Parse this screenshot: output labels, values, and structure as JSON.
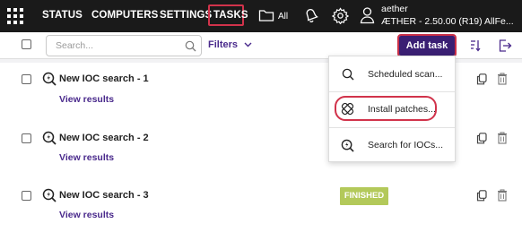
{
  "topbar": {
    "nav": [
      "STATUS",
      "COMPUTERS",
      "SETTINGS",
      "TASKS"
    ],
    "all_label": "All",
    "user_name": "aether",
    "user_version": "ÆTHER - 2.50.00 (R19) AllFe..."
  },
  "toolbar": {
    "search_placeholder": "Search...",
    "filters_label": "Filters",
    "add_task_label": "Add task"
  },
  "tasks": [
    {
      "title": "New IOC search - 1",
      "link": "View results",
      "status": ""
    },
    {
      "title": "New IOC search - 2",
      "link": "View results",
      "status": ""
    },
    {
      "title": "New IOC search - 3",
      "link": "View results",
      "status": "FINISHED"
    }
  ],
  "menu": {
    "items": [
      "Scheduled scan...",
      "Install patches...",
      "Search for IOCs..."
    ]
  },
  "colors": {
    "topbar_bg": "#1a1a1a",
    "accent": "#3a1f73",
    "link": "#4a2a8c",
    "highlight": "#d1334b",
    "status_finished": "#b3c95a"
  },
  "icons": [
    "apps-grid-icon",
    "folder-icon",
    "bell-icon",
    "gear-icon",
    "user-icon",
    "search-icon",
    "chevron-down-icon",
    "sort-icon",
    "export-icon",
    "ioc-search-icon",
    "copy-icon",
    "trash-icon",
    "patch-icon"
  ]
}
